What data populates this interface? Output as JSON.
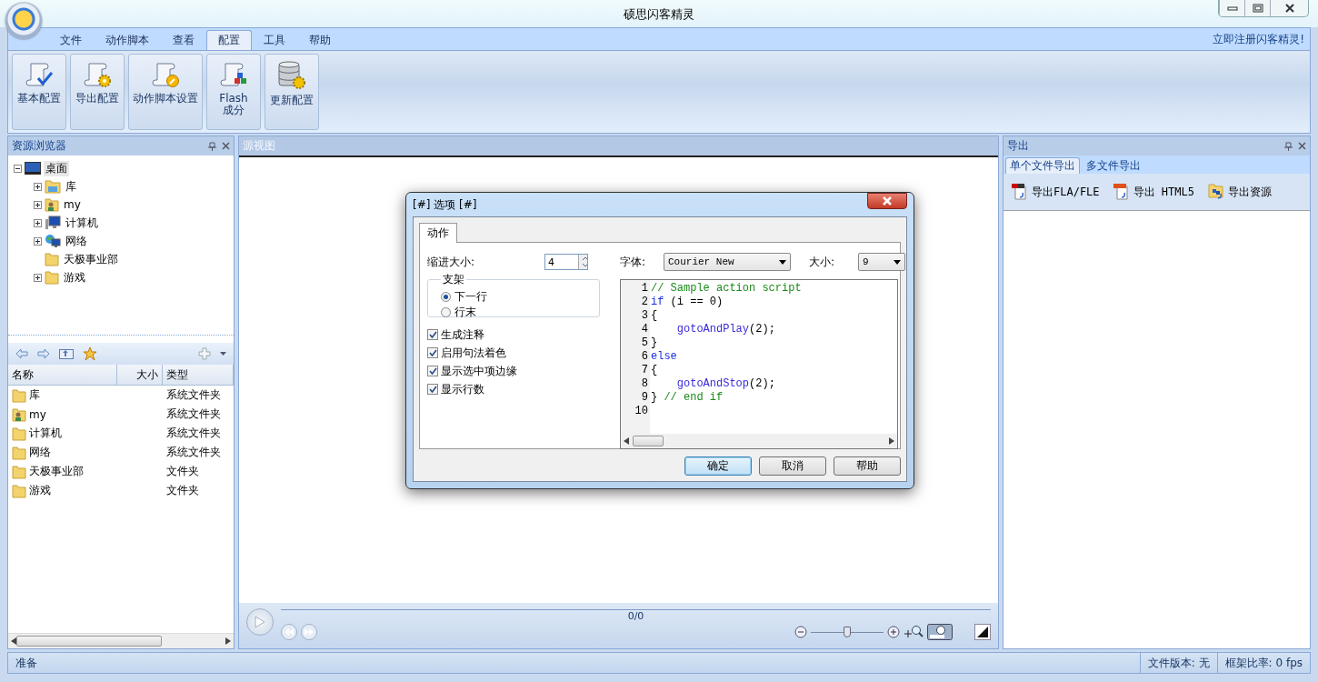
{
  "window": {
    "title": "硕思闪客精灵"
  },
  "menu": {
    "tabs": [
      {
        "label": "文件",
        "selected": false
      },
      {
        "label": "动作脚本",
        "selected": false
      },
      {
        "label": "查看",
        "selected": false
      },
      {
        "label": "配置",
        "selected": true
      },
      {
        "label": "工具",
        "selected": false
      },
      {
        "label": "帮助",
        "selected": false
      }
    ],
    "register_link": "立即注册闪客精灵!"
  },
  "ribbon": {
    "buttons": [
      {
        "label": "基本配置",
        "kind": "check"
      },
      {
        "label": "导出配置",
        "kind": "gear"
      },
      {
        "label": "动作脚本设置",
        "kind": "wrench"
      },
      {
        "label": "Flash\n成分",
        "kind": "cubes"
      },
      {
        "label": "更新配置",
        "kind": "database"
      }
    ]
  },
  "resource_browser": {
    "title": "资源浏览器",
    "tree": [
      {
        "label": "桌面",
        "kind": "desktop",
        "expandable": true,
        "expanded": true,
        "selected": true,
        "children": [
          {
            "label": "库",
            "kind": "library",
            "expandable": true,
            "expanded": false,
            "selected": false
          },
          {
            "label": "my",
            "kind": "user",
            "expandable": true,
            "expanded": false,
            "selected": false
          },
          {
            "label": "计算机",
            "kind": "computer",
            "expandable": true,
            "expanded": false,
            "selected": false
          },
          {
            "label": "网络",
            "kind": "network",
            "expandable": true,
            "expanded": false,
            "selected": false
          },
          {
            "label": "天极事业部",
            "kind": "folder",
            "expandable": false,
            "selected": false
          },
          {
            "label": "游戏",
            "kind": "folder",
            "expandable": true,
            "expanded": false,
            "selected": false
          }
        ]
      }
    ],
    "list": {
      "columns": [
        "名称",
        "大小",
        "类型"
      ],
      "rows": [
        {
          "name": "库",
          "kind": "folder",
          "type": "系统文件夹"
        },
        {
          "name": "my",
          "kind": "user",
          "type": "系统文件夹"
        },
        {
          "name": "计算机",
          "kind": "folder",
          "type": "系统文件夹"
        },
        {
          "name": "网络",
          "kind": "folder",
          "type": "系统文件夹"
        },
        {
          "name": "天极事业部",
          "kind": "folder",
          "type": "文件夹"
        },
        {
          "name": "游戏",
          "kind": "folder",
          "type": "文件夹"
        }
      ]
    }
  },
  "source_view": {
    "title": "源视图",
    "player": {
      "position": "0/0",
      "zoom": {
        "level": 0.5
      }
    }
  },
  "export_panel": {
    "title": "导出",
    "tabs": [
      {
        "label": "单个文件导出",
        "selected": true
      },
      {
        "label": "多文件导出",
        "selected": false
      }
    ],
    "buttons": [
      {
        "label": "导出FLA/FLE",
        "kind": "fla"
      },
      {
        "label": "导出 HTML5",
        "kind": "html5"
      },
      {
        "label": "导出资源",
        "kind": "resources"
      }
    ]
  },
  "dialog": {
    "title": "[#] 选项 [#]",
    "tabs": [
      {
        "label": "动作",
        "selected": true
      }
    ],
    "indent": {
      "label": "缩进大小:",
      "value": "4"
    },
    "braces": {
      "title": "支架",
      "options": [
        {
          "label": "下一行",
          "selected": true
        },
        {
          "label": "行末",
          "selected": false
        }
      ]
    },
    "checkboxes": [
      {
        "label": "生成注释",
        "checked": true
      },
      {
        "label": "启用句法着色",
        "checked": true
      },
      {
        "label": "显示选中项边缘",
        "checked": true
      },
      {
        "label": "显示行数",
        "checked": true
      }
    ],
    "font": {
      "label": "字体:",
      "value": "Courier New"
    },
    "size": {
      "label": "大小:",
      "value": "9"
    },
    "code": [
      {
        "number": "1",
        "segments": [
          {
            "kind": "comment",
            "text": "// Sample action script"
          }
        ]
      },
      {
        "number": "2",
        "segments": [
          {
            "kind": "keyword",
            "text": "if"
          },
          {
            "kind": "plain",
            "text": " (i == 0)"
          }
        ]
      },
      {
        "number": "3",
        "segments": [
          {
            "kind": "plain",
            "text": "{"
          }
        ]
      },
      {
        "number": "4",
        "segments": [
          {
            "kind": "function",
            "text": "    gotoAndPlay"
          },
          {
            "kind": "plain",
            "text": "(2);"
          }
        ]
      },
      {
        "number": "5",
        "segments": [
          {
            "kind": "plain",
            "text": "}"
          }
        ]
      },
      {
        "number": "6",
        "segments": [
          {
            "kind": "keyword",
            "text": "else"
          }
        ]
      },
      {
        "number": "7",
        "segments": [
          {
            "kind": "plain",
            "text": "{"
          }
        ]
      },
      {
        "number": "8",
        "segments": [
          {
            "kind": "function",
            "text": "    gotoAndStop"
          },
          {
            "kind": "plain",
            "text": "(2);"
          }
        ]
      },
      {
        "number": "9",
        "segments": [
          {
            "kind": "plain",
            "text": "} "
          },
          {
            "kind": "comment",
            "text": "// end if"
          }
        ]
      },
      {
        "number": "10"
      }
    ],
    "buttons": [
      {
        "label": "确定",
        "default": true
      },
      {
        "label": "取消",
        "default": false
      },
      {
        "label": "帮助",
        "default": false
      }
    ]
  },
  "status_bar": {
    "status": "准备",
    "file_version": "文件版本: 无",
    "frame_rate": "框架比率: 0 fps"
  }
}
